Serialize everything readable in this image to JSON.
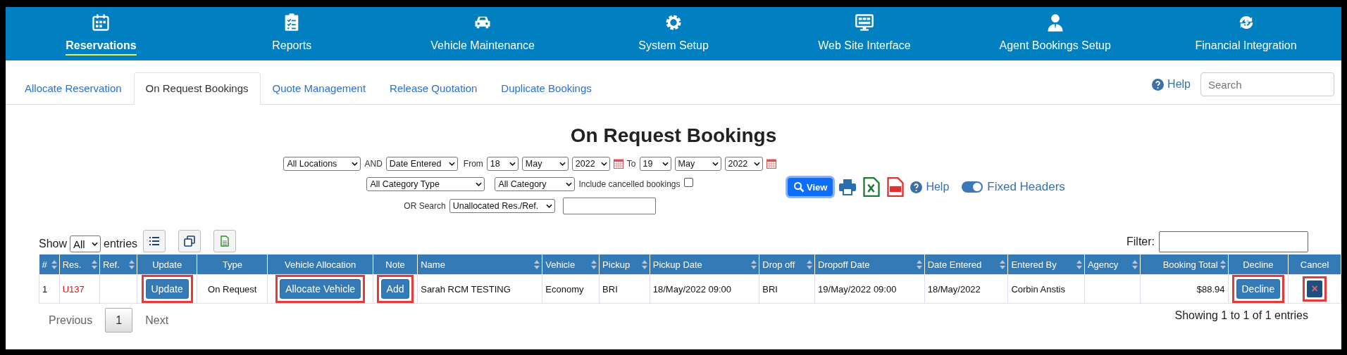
{
  "nav": [
    {
      "label": "Reservations",
      "kind": "calendar",
      "selected": true
    },
    {
      "label": "Reports",
      "kind": "checklist",
      "selected": false
    },
    {
      "label": "Vehicle Maintenance",
      "kind": "car",
      "selected": false
    },
    {
      "label": "System Setup",
      "kind": "gear",
      "selected": false
    },
    {
      "label": "Web Site Interface",
      "kind": "monitor",
      "selected": false
    },
    {
      "label": "Agent Bookings Setup",
      "kind": "person",
      "selected": false
    },
    {
      "label": "Financial Integration",
      "kind": "dollar",
      "selected": false
    }
  ],
  "tabs": [
    {
      "label": "Allocate Reservation",
      "selected": false
    },
    {
      "label": "On Request Bookings",
      "selected": true
    },
    {
      "label": "Quote Management",
      "selected": false
    },
    {
      "label": "Release Quotation",
      "selected": false
    },
    {
      "label": "Duplicate Bookings",
      "selected": false
    }
  ],
  "help_link": "Help",
  "search": {
    "placeholder": "Search"
  },
  "page_title": "On Request Bookings",
  "filters": {
    "location": "All Locations",
    "and_label": "AND",
    "date_type": "Date Entered",
    "from_label": "From",
    "from_day": "18",
    "from_month": "May",
    "from_year": "2022",
    "to_label": "To",
    "to_day": "19",
    "to_month": "May",
    "to_year": "2022",
    "category_type": "All Category Type",
    "category": "All Category",
    "include_cancelled": {
      "label": "Include cancelled bookings",
      "checked": false
    },
    "or_search_label": "OR Search",
    "search_type": "Unallocated Res./Ref."
  },
  "tools": {
    "view_button": "View",
    "help_link": "Help",
    "fixed_headers": {
      "label": "Fixed Headers",
      "on": true
    }
  },
  "table_controls": {
    "show_label": "Show",
    "page_size": "All",
    "entries_label": "entries",
    "filter_label": "Filter:"
  },
  "table": {
    "columns": [
      {
        "label": "#",
        "sortable": true,
        "kind": "text"
      },
      {
        "label": "Res.",
        "sortable": true,
        "kind": "text"
      },
      {
        "label": "Ref.",
        "sortable": true,
        "kind": "text"
      },
      {
        "label": "Update",
        "sortable": false,
        "kind": "action"
      },
      {
        "label": "Type",
        "sortable": false,
        "kind": "action"
      },
      {
        "label": "Vehicle Allocation",
        "sortable": false,
        "kind": "action"
      },
      {
        "label": "Note",
        "sortable": false,
        "kind": "action"
      },
      {
        "label": "Name",
        "sortable": true,
        "kind": "text"
      },
      {
        "label": "Vehicle",
        "sortable": true,
        "kind": "text"
      },
      {
        "label": "Pickup",
        "sortable": true,
        "kind": "text"
      },
      {
        "label": "Pickup Date",
        "sortable": true,
        "kind": "text"
      },
      {
        "label": "Drop off",
        "sortable": true,
        "kind": "text"
      },
      {
        "label": "Dropoff Date",
        "sortable": true,
        "kind": "text"
      },
      {
        "label": "Date Entered",
        "sortable": true,
        "kind": "text"
      },
      {
        "label": "Entered By",
        "sortable": true,
        "kind": "text"
      },
      {
        "label": "Agency",
        "sortable": true,
        "kind": "text"
      },
      {
        "label": "Booking Total",
        "sortable": true,
        "kind": "amount"
      },
      {
        "label": "Decline",
        "sortable": false,
        "kind": "action"
      },
      {
        "label": "Cancel",
        "sortable": false,
        "kind": "action"
      }
    ],
    "rows": [
      {
        "cells": [
          {
            "kind": "text",
            "text": "1"
          },
          {
            "kind": "link",
            "text": "U137"
          },
          {
            "kind": "empty"
          },
          {
            "kind": "button",
            "text": "Update",
            "highlighted": true
          },
          {
            "kind": "text",
            "text": "On Request"
          },
          {
            "kind": "button",
            "text": "Allocate Vehicle",
            "highlighted": true
          },
          {
            "kind": "button",
            "text": "Add",
            "highlighted": true
          },
          {
            "kind": "text",
            "text": "Sarah RCM TESTING"
          },
          {
            "kind": "text",
            "text": "Economy"
          },
          {
            "kind": "text",
            "text": "BRI"
          },
          {
            "kind": "text",
            "text": "18/May/2022 09:00"
          },
          {
            "kind": "text",
            "text": "BRI"
          },
          {
            "kind": "text",
            "text": "19/May/2022 09:00"
          },
          {
            "kind": "text",
            "text": "18/May/2022"
          },
          {
            "kind": "text",
            "text": "Corbin Anstis"
          },
          {
            "kind": "empty"
          },
          {
            "kind": "text",
            "text": "$88.94"
          },
          {
            "kind": "button",
            "text": "Decline",
            "highlighted": true
          },
          {
            "kind": "cancel",
            "text": "×",
            "highlighted": true
          }
        ]
      }
    ]
  },
  "pagination": {
    "previous": "Previous",
    "pages": [
      {
        "label": "1",
        "selected": true
      }
    ],
    "next": "Next"
  },
  "info": "Showing 1 to 1 of 1 entries"
}
